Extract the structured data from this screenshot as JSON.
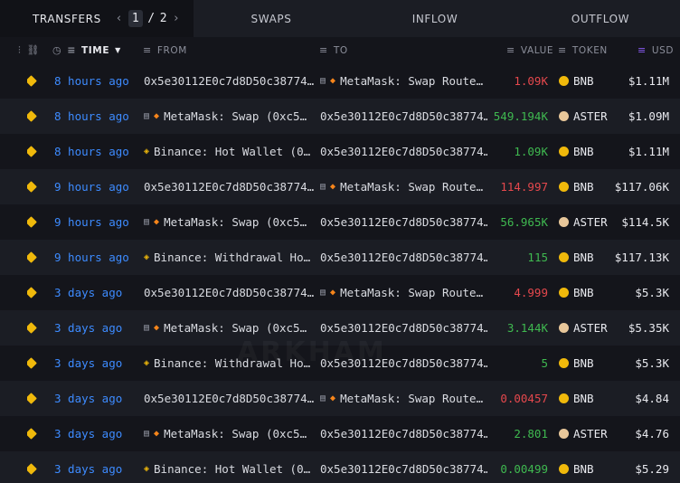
{
  "tabs": {
    "transfers": "TRANSFERS",
    "page_current": "1",
    "page_sep": "/",
    "page_total": "2",
    "swaps": "SWAPS",
    "inflow": "INFLOW",
    "outflow": "OUTFLOW"
  },
  "columns": {
    "time": "TIME",
    "from": "FROM",
    "to": "TO",
    "value": "VALUE",
    "token": "TOKEN",
    "usd": "USD"
  },
  "watermark": "ARKHAM",
  "rows": [
    {
      "time": "8 hours ago",
      "from": "0x5e30112E0c7d8D50c38774…",
      "to": "MetaMask: Swap Route…",
      "value": "1.09K",
      "token": "BNB",
      "usd": "$1.11M"
    },
    {
      "time": "8 hours ago",
      "from": "MetaMask: Swap (0xc5…",
      "to": "0x5e30112E0c7d8D50c38774…",
      "value": "549.194K",
      "token": "ASTER",
      "usd": "$1.09M"
    },
    {
      "time": "8 hours ago",
      "from": "Binance: Hot Wallet (0…",
      "to": "0x5e30112E0c7d8D50c38774…",
      "value": "1.09K",
      "token": "BNB",
      "usd": "$1.11M"
    },
    {
      "time": "9 hours ago",
      "from": "0x5e30112E0c7d8D50c38774…",
      "to": "MetaMask: Swap Route…",
      "value": "114.997",
      "token": "BNB",
      "usd": "$117.06K"
    },
    {
      "time": "9 hours ago",
      "from": "MetaMask: Swap (0xc5…",
      "to": "0x5e30112E0c7d8D50c38774…",
      "value": "56.965K",
      "token": "ASTER",
      "usd": "$114.5K"
    },
    {
      "time": "9 hours ago",
      "from": "Binance: Withdrawal Ho…",
      "to": "0x5e30112E0c7d8D50c38774…",
      "value": "115",
      "token": "BNB",
      "usd": "$117.13K"
    },
    {
      "time": "3 days ago",
      "from": "0x5e30112E0c7d8D50c38774…",
      "to": "MetaMask: Swap Route…",
      "value": "4.999",
      "token": "BNB",
      "usd": "$5.3K"
    },
    {
      "time": "3 days ago",
      "from": "MetaMask: Swap (0xc5…",
      "to": "0x5e30112E0c7d8D50c38774…",
      "value": "3.144K",
      "token": "ASTER",
      "usd": "$5.35K"
    },
    {
      "time": "3 days ago",
      "from": "Binance: Withdrawal Ho…",
      "to": "0x5e30112E0c7d8D50c38774…",
      "value": "5",
      "token": "BNB",
      "usd": "$5.3K"
    },
    {
      "time": "3 days ago",
      "from": "0x5e30112E0c7d8D50c38774…",
      "to": "MetaMask: Swap Route…",
      "value": "0.00457",
      "token": "BNB",
      "usd": "$4.84"
    },
    {
      "time": "3 days ago",
      "from": "MetaMask: Swap (0xc5…",
      "to": "0x5e30112E0c7d8D50c38774…",
      "value": "2.801",
      "token": "ASTER",
      "usd": "$4.76"
    },
    {
      "time": "3 days ago",
      "from": "Binance: Hot Wallet (0…",
      "to": "0x5e30112E0c7d8D50c38774…",
      "value": "0.00499",
      "token": "BNB",
      "usd": "$5.29"
    }
  ]
}
